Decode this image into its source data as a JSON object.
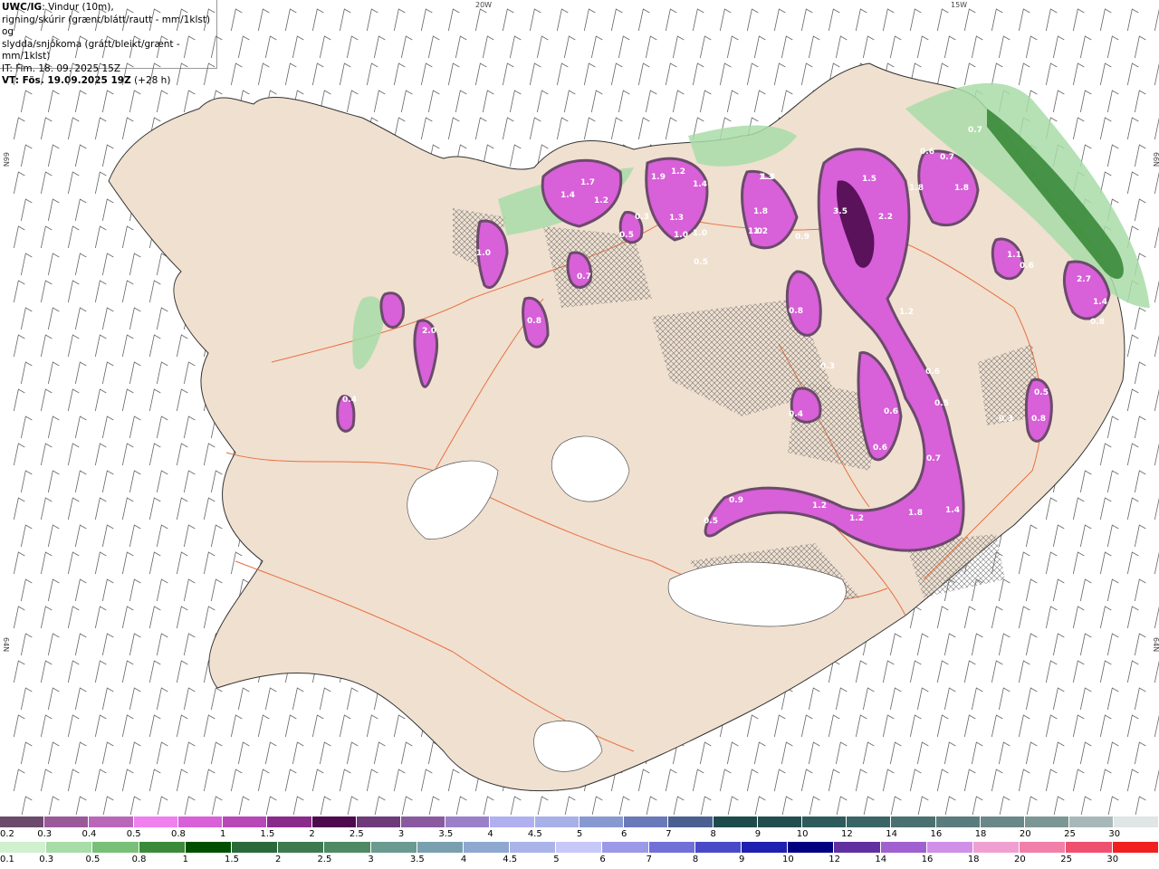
{
  "title": {
    "product": "UWC/IG",
    "line1_rest": ": Vindur (10m),",
    "line2": "rigning/skúrir (grænt/blátt/rautt - mm/1klst) og",
    "line3": "slydda/snjókoma (grátt/bleikt/grænt - mm/1klst)",
    "it": "IT: Fim. 18. 09. 2025 15Z",
    "vt_bold": "VT: Fös. 19.09.2025 19Z",
    "vt_rest": " (+28 h)"
  },
  "axis_labels": {
    "top_20w": "20W",
    "top_15w": "15W",
    "left_66n": "66N",
    "right_66n": "66N",
    "left_64n": "64N",
    "right_64n": "64N"
  },
  "precip_labels": [
    "1.4",
    "1.7",
    "1.2",
    "1.9",
    "1.2",
    "1.4",
    "1.3",
    "1.8",
    "1.5",
    "3.5",
    "2.2",
    "1.8",
    "0.6",
    "0.7",
    "0.7",
    "1.0",
    "1.2",
    "1.3",
    "1.0",
    "1.0",
    "0.5",
    "0.3",
    "0.5",
    "0.7",
    "2.0",
    "0.4",
    "0.8",
    "1.8",
    "1.0",
    "0.9",
    "0.8",
    "0.3",
    "0.4",
    "1.2",
    "0.6",
    "0.5",
    "0.6",
    "0.7",
    "0.5",
    "0.3",
    "0.6",
    "0.9",
    "0.5",
    "1.2",
    "1.2",
    "1.8",
    "1.4",
    "2.7",
    "1.4",
    "0.8",
    "1.1",
    "0.8",
    "1.3",
    "0.6"
  ],
  "legend_top": {
    "labels": [
      "0.2",
      "0.3",
      "0.4",
      "0.5",
      "0.8",
      "1",
      "1.5",
      "2",
      "2.5",
      "3",
      "3.5",
      "4",
      "4.5",
      "5",
      "6",
      "7",
      "8",
      "9",
      "10",
      "12",
      "14",
      "16",
      "18",
      "20",
      "25",
      "30"
    ],
    "colors": [
      "#6b4a6b",
      "#9a5a9a",
      "#b967b9",
      "#f080f0",
      "#d860d8",
      "#b848b8",
      "#8a2a8a",
      "#4d0a4d",
      "#6e3a7a",
      "#8a5aa0",
      "#9a80c8",
      "#b0b0f0",
      "#a8b0e8",
      "#8898d0",
      "#6a7ab8",
      "#4a6090",
      "#1e4a4a",
      "#234e50",
      "#2e5a5c",
      "#3a6466",
      "#4a7070",
      "#5a7c7c",
      "#6a8888",
      "#7c9696",
      "#a8b8b8",
      "#e0e6e6"
    ]
  },
  "legend_bottom": {
    "labels": [
      "0.1",
      "0.3",
      "0.5",
      "0.8",
      "1",
      "1.5",
      "2",
      "2.5",
      "3",
      "3.5",
      "4",
      "4.5",
      "5",
      "6",
      "7",
      "8",
      "9",
      "10",
      "12",
      "14",
      "16",
      "18",
      "20",
      "25",
      "30"
    ],
    "colors": [
      "#d0f0d0",
      "#a8dca8",
      "#78c078",
      "#3a8a3a",
      "#005000",
      "#2a6a3a",
      "#3e7a50",
      "#4e8a64",
      "#6a9a90",
      "#7aa0b0",
      "#8ea8d0",
      "#aab4e8",
      "#c8c8f8",
      "#9a9ae8",
      "#7070d8",
      "#4a4ac8",
      "#2020b0",
      "#000080",
      "#6030a0",
      "#a060d0",
      "#d090e8",
      "#f0a0d0",
      "#f080a8",
      "#f05070",
      "#f02020"
    ]
  },
  "colors": {
    "land": "#f0e0d0",
    "sea": "#ffffff",
    "roads": "#e87040",
    "glacier": "#ffffff",
    "coast": "#333333"
  }
}
